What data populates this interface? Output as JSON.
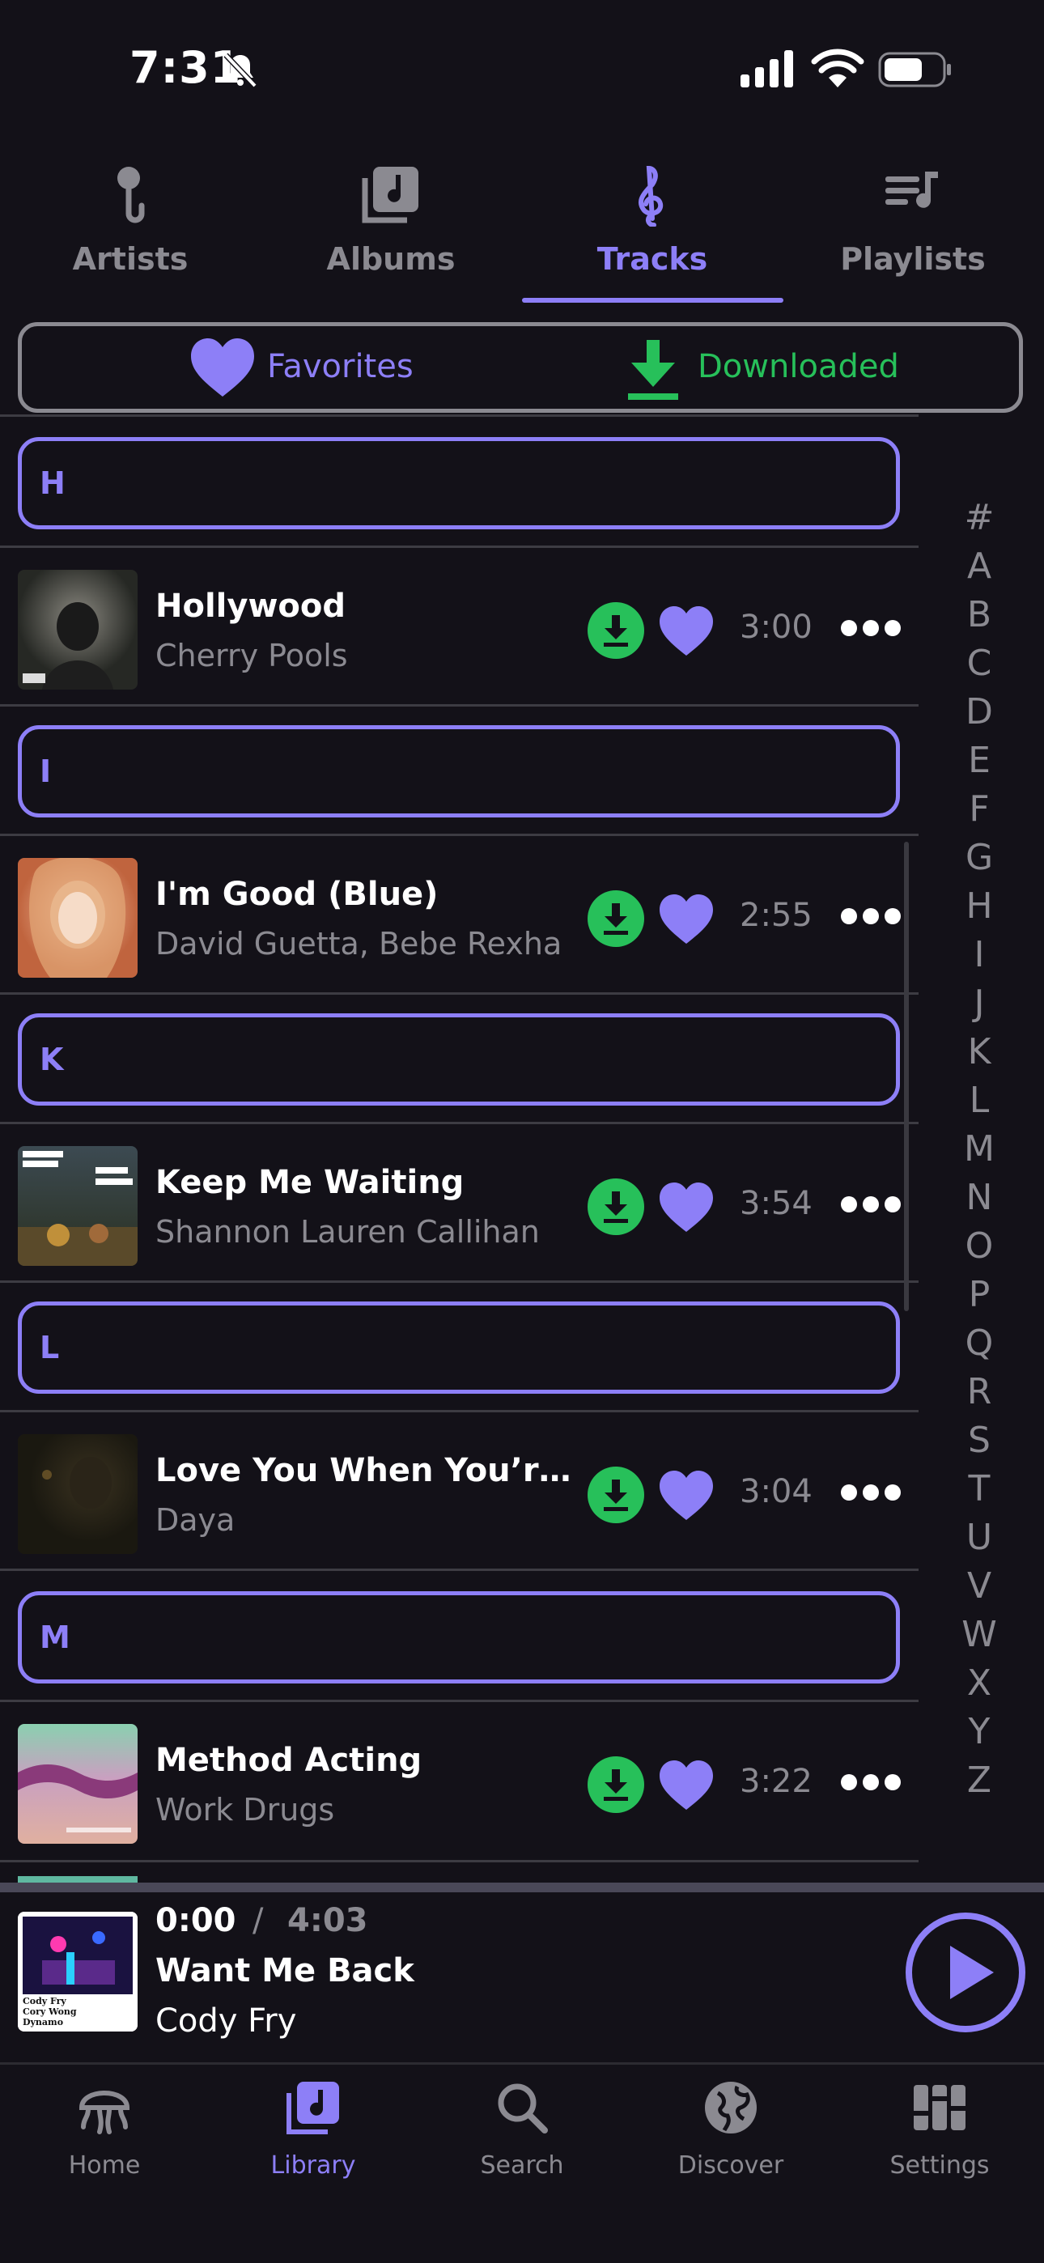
{
  "status": {
    "time": "7:31"
  },
  "tabs": [
    {
      "label": "Artists"
    },
    {
      "label": "Albums"
    },
    {
      "label": "Tracks"
    },
    {
      "label": "Playlists"
    }
  ],
  "filters": {
    "favorites": "Favorites",
    "downloaded": "Downloaded"
  },
  "sections": [
    {
      "letter": "H",
      "track": {
        "title": "Hollywood",
        "artist": "Cherry Pools",
        "duration": "3:00"
      }
    },
    {
      "letter": "I",
      "track": {
        "title": "I'm Good (Blue)",
        "artist": "David Guetta, Bebe Rexha",
        "duration": "2:55"
      }
    },
    {
      "letter": "K",
      "track": {
        "title": "Keep Me Waiting",
        "artist": "Shannon Lauren Callihan",
        "duration": "3:54"
      }
    },
    {
      "letter": "L",
      "track": {
        "title": "Love You When You’re Gone",
        "artist": "Daya",
        "duration": "3:04"
      }
    },
    {
      "letter": "M",
      "track": {
        "title": "Method Acting",
        "artist": "Work Drugs",
        "duration": "3:22"
      }
    }
  ],
  "alphabet": [
    "#",
    "A",
    "B",
    "C",
    "D",
    "E",
    "F",
    "G",
    "H",
    "I",
    "J",
    "K",
    "L",
    "M",
    "N",
    "O",
    "P",
    "Q",
    "R",
    "S",
    "T",
    "U",
    "V",
    "W",
    "X",
    "Y",
    "Z"
  ],
  "now_playing": {
    "elapsed": "0:00",
    "separator": "/",
    "total": "4:03",
    "title": "Want Me Back",
    "artist": "Cody Fry",
    "art_text": [
      "Cody Fry",
      "Cory Wong",
      "Dynamo"
    ]
  },
  "bottom_nav": [
    {
      "label": "Home"
    },
    {
      "label": "Library"
    },
    {
      "label": "Search"
    },
    {
      "label": "Discover"
    },
    {
      "label": "Settings"
    }
  ],
  "colors": {
    "accent": "#8d7ff7",
    "download": "#27c05a",
    "muted": "#8b8a91",
    "background": "#131118"
  }
}
